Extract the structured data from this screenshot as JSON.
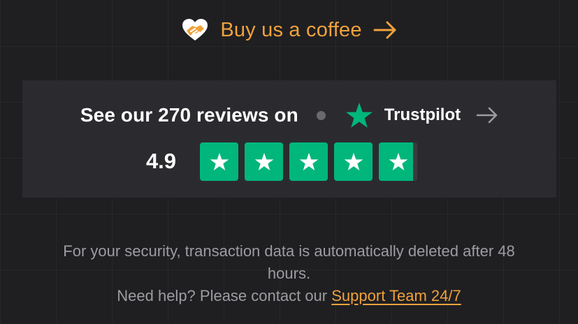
{
  "coffee": {
    "label": "Buy us a coffee",
    "icon": "heart-handshake-icon",
    "arrow_icon": "arrow-right-icon"
  },
  "trustpilot": {
    "headline": "See our 270 reviews on",
    "brand": "Trustpilot",
    "score": "4.9",
    "rating": 4.9,
    "max_rating": 5,
    "logo_icon": "trustpilot-star-icon",
    "arrow_icon": "arrow-right-icon"
  },
  "footer": {
    "security_text": "For your security, transaction data is automatically deleted after 48 hours.",
    "help_text": "Need help? Please contact our",
    "support_link": "Support Team 24/7"
  },
  "colors": {
    "background": "#1f1f22",
    "card": "#2b2b2f",
    "accent": "#f0a23b",
    "trustpilot_green": "#00b67a",
    "muted_text": "#9c9ca1"
  }
}
